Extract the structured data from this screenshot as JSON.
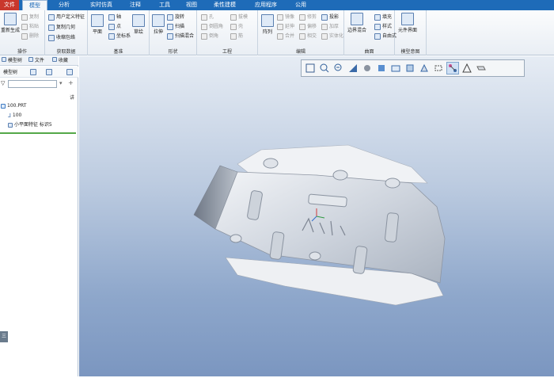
{
  "menu": {
    "file": "文件",
    "items": [
      "模型",
      "分析",
      "实时仿真",
      "注释",
      "工具",
      "视图",
      "柔性建模",
      "应用程序",
      "公用"
    ]
  },
  "ribbon": {
    "operations": {
      "regenerate": "重新生成",
      "copy": "复制",
      "paste": "粘贴",
      "delete": "删除",
      "label": "操作"
    },
    "get_data": {
      "udf": "用户定义特征",
      "copy_geometry": "复制几何",
      "shrinkwrap": "收缩包络",
      "label": "获取数据"
    },
    "datum": {
      "plane": "平面",
      "axis": "轴",
      "point": "点",
      "csys": "坐标系",
      "sketch": "草绘",
      "label": "基准"
    },
    "shapes": {
      "extrude": "拉伸",
      "revolve": "旋转",
      "sweep": "扫描",
      "swept_blend": "扫描混合",
      "label": "形状"
    },
    "engineering": {
      "hole": "孔",
      "draft": "拔模",
      "round": "倒圆角",
      "shell": "壳",
      "chamfer": "倒角",
      "rib": "筋",
      "label": "工程"
    },
    "editing": {
      "pattern": "阵列",
      "mirror": "镜像",
      "extend": "延伸",
      "project": "投影",
      "trim": "修剪",
      "offset": "偏移",
      "thicken": "加厚",
      "merge": "合并",
      "intersect": "相交",
      "solidify": "实体化",
      "label": "编辑"
    },
    "surfaces": {
      "boundary_blend": "边界混合",
      "fill": "填充",
      "style": "样式",
      "freestyle": "自由式",
      "label": "曲面"
    },
    "model_intent": {
      "component_interface": "元件界面",
      "label": "模型意图"
    }
  },
  "left_panel": {
    "tabs": [
      "模型树",
      "文件",
      "收藏"
    ],
    "toolbar_label": "模型树",
    "settings_text": "讲",
    "tree": [
      {
        "label": "100.PRT"
      },
      {
        "label": "100"
      },
      {
        "label": "小平面特征 标识5"
      }
    ],
    "side_button": "三"
  },
  "colors": {
    "menubar": "#1e6bb8",
    "file_tab": "#c9372c",
    "viewport_top": "#e6ecf4",
    "viewport_bottom": "#7b96c0",
    "tree_separator": "#54a848"
  },
  "view_toolbar": {
    "icons": [
      "refit-icon",
      "zoom-in-icon",
      "zoom-out-icon",
      "reorient-icon",
      "saved-views-icon",
      "display-style-icon",
      "view-manager-icon",
      "perspective-icon",
      "section-icon",
      "datum-display-icon",
      "spin-center-icon",
      "annotation-display-icon",
      "appearance-icon"
    ]
  }
}
